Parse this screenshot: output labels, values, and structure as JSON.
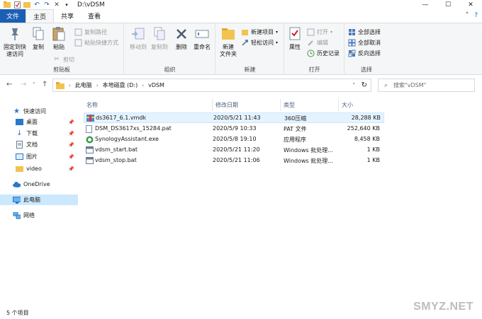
{
  "window": {
    "path_title": "D:\\vDSM",
    "controls": {
      "minimize": "—",
      "maximize": "☐",
      "close": "✕"
    }
  },
  "tabs": [
    "文件",
    "主页",
    "共享",
    "查看"
  ],
  "ribbon": {
    "clipboard": {
      "label": "剪贴板",
      "pin_quick": "固定到快\n速访问",
      "copy": "复制",
      "paste": "粘贴",
      "copy_path": "复制路径",
      "paste_shortcut": "粘贴快捷方式",
      "cut": "剪切"
    },
    "organize": {
      "label": "组织",
      "move_to": "移动到",
      "copy_to": "复制到",
      "delete": "删除",
      "rename": "重命名"
    },
    "new": {
      "label": "新建",
      "new_folder": "新建\n文件夹",
      "new_item": "新建项目",
      "easy_access": "轻松访问"
    },
    "open": {
      "label": "打开",
      "properties": "属性",
      "open": "打开",
      "edit": "编辑",
      "history": "历史记录"
    },
    "select": {
      "label": "选择",
      "select_all": "全部选择",
      "select_none": "全部取消",
      "invert": "反向选择"
    }
  },
  "address": {
    "segments": [
      "此电脑",
      "本地磁盘 (D:)",
      "vDSM"
    ],
    "search_placeholder": "搜索\"vDSM\""
  },
  "nav": {
    "quick_access": "快速访问",
    "items": [
      {
        "label": "桌面",
        "pinned": true
      },
      {
        "label": "下载",
        "pinned": true
      },
      {
        "label": "文档",
        "pinned": true
      },
      {
        "label": "图片",
        "pinned": true
      },
      {
        "label": "video",
        "pinned": true
      }
    ],
    "onedrive": "OneDrive",
    "this_pc": "此电脑",
    "network": "网络"
  },
  "columns": {
    "name": "名称",
    "modified": "修改日期",
    "type": "类型",
    "size": "大小"
  },
  "files": [
    {
      "name": "ds3617_6.1.vmdk",
      "modified": "2020/5/21 11:43",
      "type": "360压缩",
      "size": "28,288 KB",
      "icon": "archive-icon"
    },
    {
      "name": "DSM_DS3617xs_15284.pat",
      "modified": "2020/5/9 10:33",
      "type": "PAT 文件",
      "size": "252,640 KB",
      "icon": "file-icon"
    },
    {
      "name": "SynologyAssistant.exe",
      "modified": "2020/5/8 19:10",
      "type": "应用程序",
      "size": "8,458 KB",
      "icon": "app-icon"
    },
    {
      "name": "vdsm_start.bat",
      "modified": "2020/5/21 11:20",
      "type": "Windows 批处理...",
      "size": "1 KB",
      "icon": "batch-icon"
    },
    {
      "name": "vdsm_stop.bat",
      "modified": "2020/5/21 11:06",
      "type": "Windows 批处理...",
      "size": "1 KB",
      "icon": "batch-icon"
    }
  ],
  "status": {
    "count": "5 个项目"
  },
  "watermark": "SMYZ.NET",
  "colors": {
    "accent": "#1a5fb4",
    "selected": "#cce8ff",
    "folder": "#f2c34e"
  }
}
